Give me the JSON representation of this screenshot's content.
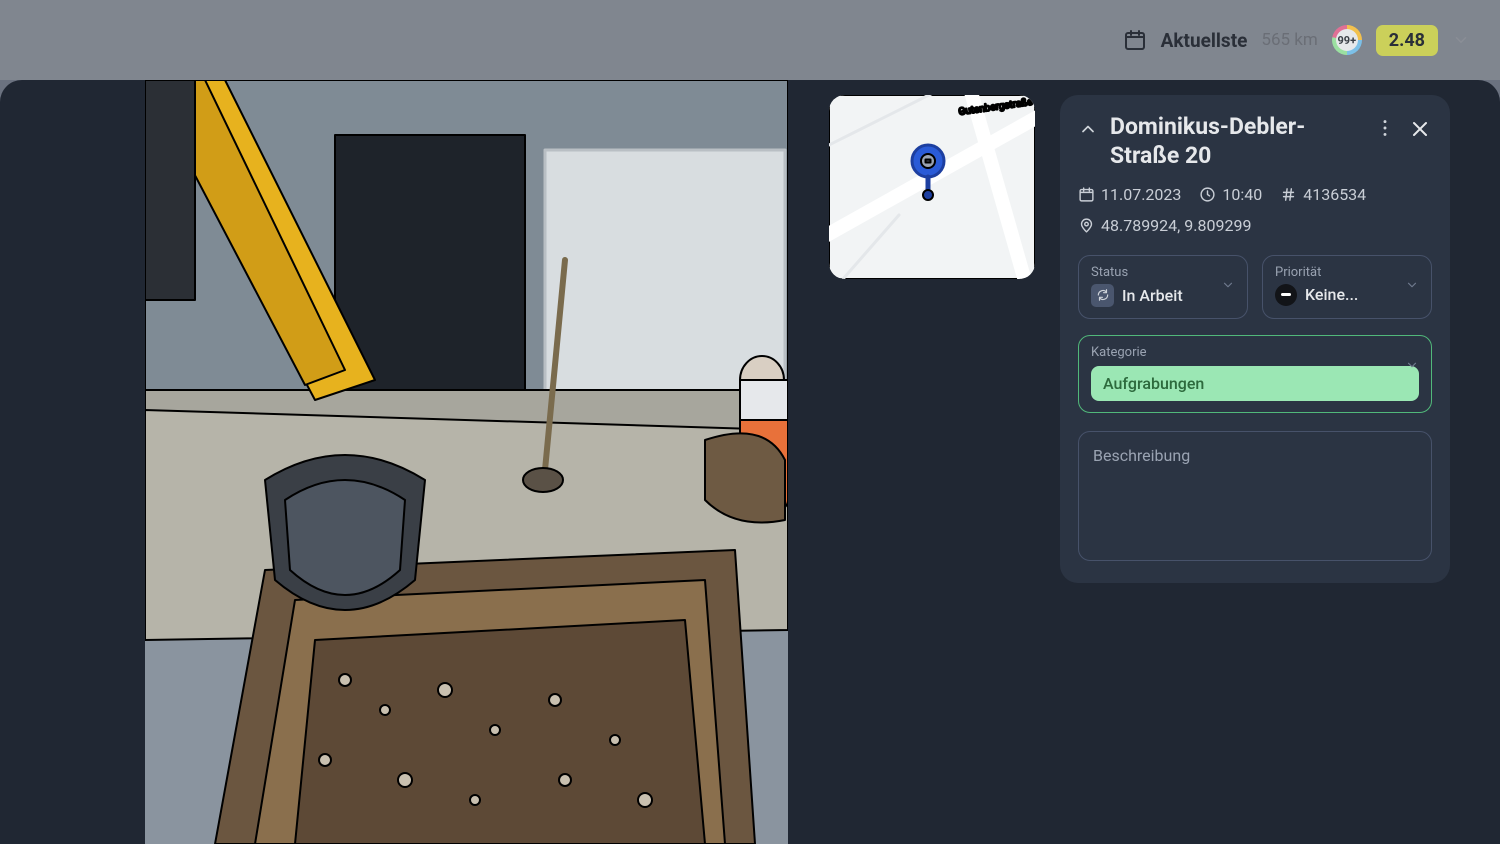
{
  "topbar": {
    "sort_label": "Aktuellste",
    "distance": "565 km",
    "count_badge": "99+",
    "score": "2.48"
  },
  "map": {
    "street_label": "Gutenbergstraße"
  },
  "detail": {
    "title": "Dominikus-Debler-Straße 20",
    "date": "11.07.2023",
    "time": "10:40",
    "id": "4136534",
    "coords": "48.789924, 9.809299",
    "status": {
      "label": "Status",
      "value": "In Arbeit"
    },
    "priority": {
      "label": "Priorität",
      "value": "Keine..."
    },
    "category": {
      "label": "Kategorie",
      "value": "Aufgrabungen"
    },
    "description_label": "Beschreibung"
  }
}
